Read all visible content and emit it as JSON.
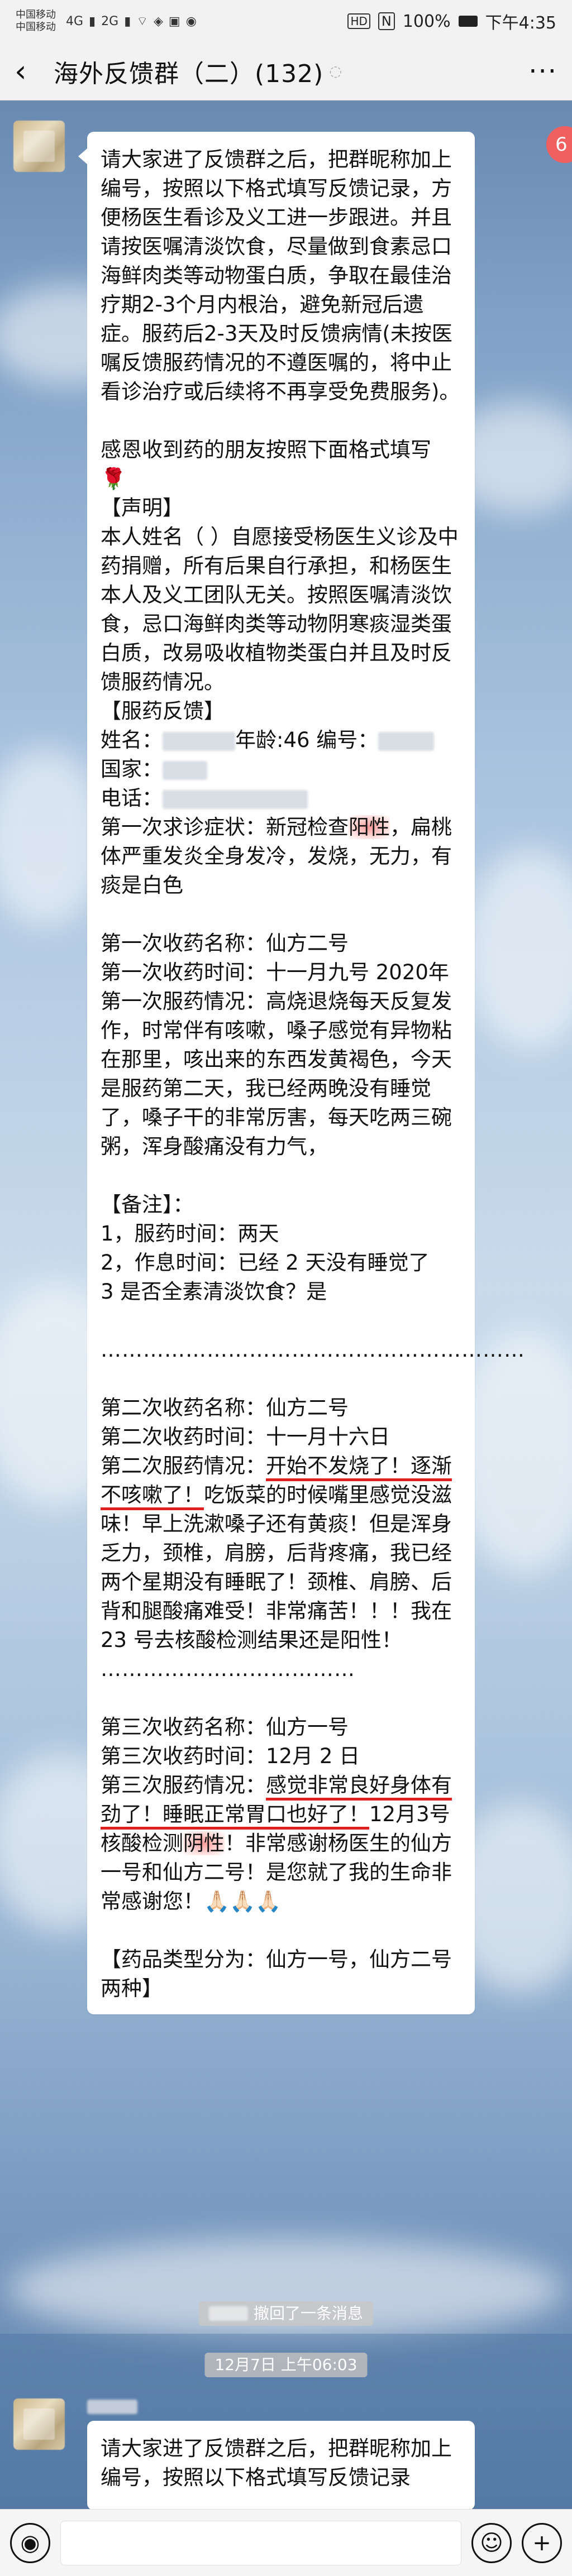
{
  "status_bar": {
    "carrier1": "中国移动",
    "carrier2": "中国移动",
    "signal1": "4G",
    "signal2": "2G",
    "battery": "100%",
    "time": "下午4:35",
    "hd": "HD",
    "nfc": "N"
  },
  "nav": {
    "title": "海外反馈群（二）(132)",
    "back_icon": "‹",
    "more_icon": "···"
  },
  "badge": "6",
  "message1": {
    "intro": "请大家进了反馈群之后，把群昵称加上编号，按照以下格式填写反馈记录，方便杨医生看诊及义工进一步跟进。并且请按医嘱清淡饮食，尽量做到食素忌口海鲜肉类等动物蛋白质，争取在最佳治疗期2-3个月内根治，避免新冠后遗症。服药后2-3天及时反馈病情(未按医嘱反馈服药情况的不遵医嘱的，将中止看诊治疗或后续将不再享受免费服务)。",
    "thanks": "感恩收到药的朋友按照下面格式填写",
    "rose": "🌹",
    "declaration_title": "【声明】",
    "declaration": "本人姓名（ ）自愿接受杨医生义诊及中药捐赠，所有后果自行承担，和杨医生本人及义工团队无关。按照医嘱清淡饮食，忌口海鲜肉类等动物阴寒痰湿类蛋白质，改易吸收植物类蛋白并且及时反馈服药情况。",
    "feedback_title": "【服药反馈】",
    "name_prefix": "姓名：",
    "age_part": "年龄:46 编号：",
    "country_prefix": "国家：",
    "phone_prefix": "电话：",
    "first_symptom_a": "第一次求诊症状：新冠检查",
    "first_symptom_hl": "阳性",
    "first_symptom_b": "，扁桃体严重发炎全身发冷，发烧，无力，有痰是白色",
    "first_med_name": "第一次收药名称：仙方二号",
    "first_med_time": "第一次收药时间：十一月九号 2020年",
    "first_med_status": "第一次服药情况：高烧退烧每天反复发作，时常伴有咳嗽，嗓子感觉有异物粘在那里，咳出来的东西发黄褐色，今天是服药第二天，我已经两晚没有睡觉了，嗓子干的非常厉害，每天吃两三碗粥，浑身酸痛没有力气，",
    "remark_title": "【备注】：",
    "remark1": "1，服药时间：两天",
    "remark2": "2，作息时间：已经 2 天没有睡觉了",
    "remark3": "3 是否全素清淡饮食？是",
    "dots1": "……………………………………………………",
    "second_med_name": "第二次收药名称：仙方二号",
    "second_med_time": "第二次收药时间：十一月十六日",
    "second_status_a": "第二次服药情况：",
    "second_status_ul": "开始不发烧了！逐渐不咳嗽了！",
    "second_status_b": "吃饭菜的时候嘴里感觉没滋味！早上洗漱嗓子还有黄痰！但是浑身乏力，颈椎，肩膀，后背疼痛，我已经两个星期没有睡眠了！颈椎、肩膀、后背和腿酸痛难受！非常痛苦！！！我在 23 号去核酸检测结果还是阳性！",
    "dots2": "………………………………",
    "third_med_name": "第三次收药名称：仙方一号",
    "third_med_time": "第三次收药时间：12月 2 日",
    "third_status_a": "第三次服药情况：",
    "third_status_ul": "感觉非常良好身体有劲了！睡眠正常胃口也好了！",
    "third_status_b1": "12月3号核酸检测",
    "third_status_hl": "阴性",
    "third_status_b2": "！非常感谢杨医生的仙方一号和仙方二号！是您就了我的生命非常感谢您！",
    "praying_hands": "🙏🏻🙏🏻🙏🏻",
    "types_title": "【药品类型分为：仙方一号，仙方二号 两种】"
  },
  "system_recall": "撤回了一条消息",
  "timestamp": "12月7日 上午06:03",
  "message2": {
    "intro": "请大家进了反馈群之后，把群昵称加上编号，按照以下格式填写反馈记录"
  },
  "input_bar": {
    "voice_icon": "◉",
    "emoji_icon": "☺",
    "plus_icon": "+"
  }
}
